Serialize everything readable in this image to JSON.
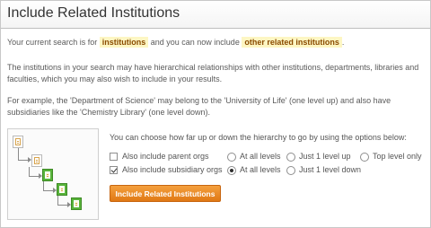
{
  "header": {
    "title": "Include Related Institutions"
  },
  "intro": {
    "prefix": "Your current search is for",
    "current": "institutions",
    "middle": "and you can now include",
    "related": "other related institutions",
    "suffix": "."
  },
  "description": "The institutions in your search may have hierarchical relationships with other institutions, departments, libraries and faculties, which you may also wish to include in your results.",
  "example": "For example, the 'Department of Science' may belong to the 'University of Life' (one level up) and also have subsidiaries like the 'Chemistry Library' (one level down).",
  "options": {
    "instruction": "You can choose how far up or down the hierarchy to go by using the options below:",
    "parent": {
      "label": "Also include parent orgs",
      "checked": false,
      "choices": [
        {
          "label": "At all levels",
          "selected": false
        },
        {
          "label": "Just 1 level up",
          "selected": false
        },
        {
          "label": "Top level only",
          "selected": false
        }
      ]
    },
    "subsidiary": {
      "label": "Also include subsidiary orgs",
      "checked": true,
      "choices": [
        {
          "label": "At all levels",
          "selected": true
        },
        {
          "label": "Just 1 level down",
          "selected": false
        }
      ]
    }
  },
  "button": {
    "label": "Include Related Institutions"
  },
  "colors": {
    "highlight_bg": "#fdf6c3",
    "highlight_text": "#8a4b00",
    "button": "#e88a25",
    "node_green": "#58b33a"
  }
}
